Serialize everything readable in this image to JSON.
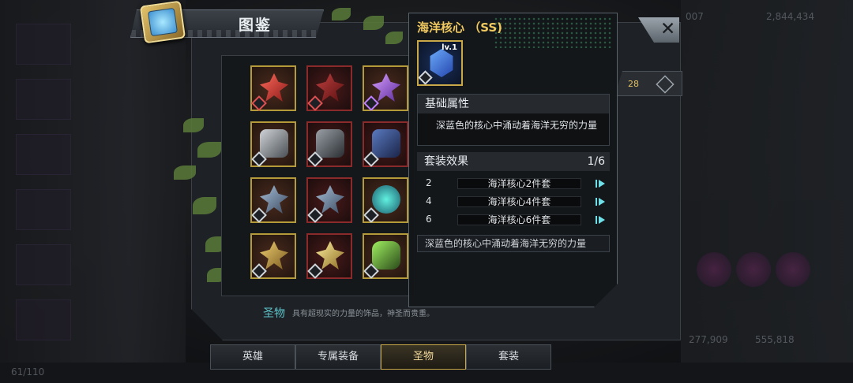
{
  "header": {
    "title": "图鉴"
  },
  "popup": {
    "title": "海洋核心 （SS)",
    "level": "lv.1",
    "base_attr_label": "基础属性",
    "description": "深蓝色的核心中涌动着海洋无穷的力量",
    "set_label": "套装效果",
    "set_ratio": "1/6",
    "set_rows": [
      {
        "count": "2",
        "name": "海洋核心2件套"
      },
      {
        "count": "4",
        "name": "海洋核心4件套"
      },
      {
        "count": "6",
        "name": "海洋核心6件套"
      }
    ],
    "footer_desc": "深蓝色的核心中涌动着海洋无穷的力量",
    "close_glyph": "✕"
  },
  "category": {
    "name": "圣物",
    "description": "具有超现实的力量的饰品，神圣而贵重。"
  },
  "count_badge": "28",
  "tabs": [
    {
      "label": "英雄",
      "active": false
    },
    {
      "label": "专属装备",
      "active": false
    },
    {
      "label": "圣物",
      "active": true
    },
    {
      "label": "套装",
      "active": false
    }
  ],
  "background": {
    "resource_left": "2,844,434",
    "resource_top": "007",
    "stat_a": "277,909",
    "stat_b": "555,818",
    "bottom_left": "61/110"
  },
  "item_grid": {
    "rows": [
      [
        {
          "kind": "red-crystal"
        },
        {
          "kind": "red-crystal"
        },
        {
          "kind": "purple-crystal"
        }
      ],
      [
        {
          "kind": "gray-core"
        },
        {
          "kind": "gray-core"
        },
        {
          "kind": "blue-core"
        }
      ],
      [
        {
          "kind": "steel-star"
        },
        {
          "kind": "steel-star"
        },
        {
          "kind": "teal-orb"
        }
      ],
      [
        {
          "kind": "gold-star"
        },
        {
          "kind": "gold-star"
        },
        {
          "kind": "green-mace"
        }
      ]
    ]
  },
  "colors": {
    "accent_gold": "#c9a84a",
    "title_gold": "#f0c860",
    "caption_teal": "#5ec3c9",
    "play_cyan": "#6fe0e8"
  }
}
